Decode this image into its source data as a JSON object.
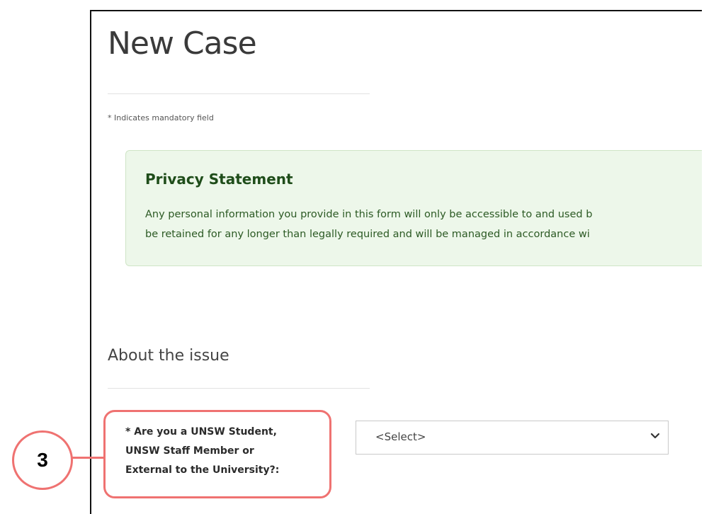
{
  "page": {
    "title": "New Case",
    "mandatory_note": "* Indicates mandatory field"
  },
  "privacy": {
    "heading": "Privacy Statement",
    "line1": "Any personal information you provide in this form will only be accessible to and used b",
    "line2": "be retained for any longer than legally required and will be managed in accordance wi"
  },
  "section": {
    "title": "About the issue"
  },
  "question": {
    "line1": "* Are you a UNSW Student,",
    "line2": "UNSW Staff Member or",
    "line3": "External to the University?:",
    "select_value": "<Select>",
    "chevron_icon": "chevron-down-icon"
  },
  "annotation": {
    "number": "3",
    "color": "#ef7271"
  }
}
